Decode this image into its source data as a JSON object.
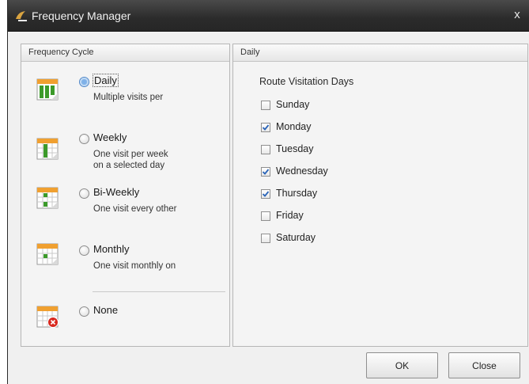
{
  "window": {
    "title": "Frequency Manager",
    "close_glyph": "x",
    "icon": "app-flame-icon"
  },
  "frequency_cycle": {
    "header": "Frequency Cycle",
    "options": [
      {
        "label": "Daily",
        "desc_lines": [
          "Multiple visits per"
        ],
        "selected": true,
        "icon": "calendar-daily-icon"
      },
      {
        "label": "Weekly",
        "desc_lines": [
          "One visit per week",
          "on a selected day"
        ],
        "selected": false,
        "icon": "calendar-weekly-icon"
      },
      {
        "label": "Bi-Weekly",
        "desc_lines": [
          "One visit every other"
        ],
        "selected": false,
        "icon": "calendar-biweekly-icon"
      },
      {
        "label": "Monthly",
        "desc_lines": [
          "One visit monthly on"
        ],
        "selected": false,
        "icon": "calendar-monthly-icon"
      },
      {
        "label": "None",
        "desc_lines": [],
        "selected": false,
        "icon": "calendar-none-icon"
      }
    ]
  },
  "daily_panel": {
    "header": "Daily",
    "route_label": "Route Visitation Days",
    "days": [
      {
        "label": "Sunday",
        "checked": false
      },
      {
        "label": "Monday",
        "checked": true
      },
      {
        "label": "Tuesday",
        "checked": false
      },
      {
        "label": "Wednesday",
        "checked": true
      },
      {
        "label": "Thursday",
        "checked": true
      },
      {
        "label": "Friday",
        "checked": false
      },
      {
        "label": "Saturday",
        "checked": false
      }
    ]
  },
  "buttons": {
    "ok": "OK",
    "close": "Close"
  },
  "colors": {
    "calendar_header": "#f0a030",
    "calendar_green": "#3c9a2a",
    "check_blue": "#2a64b8",
    "none_badge": "#d8281e"
  }
}
